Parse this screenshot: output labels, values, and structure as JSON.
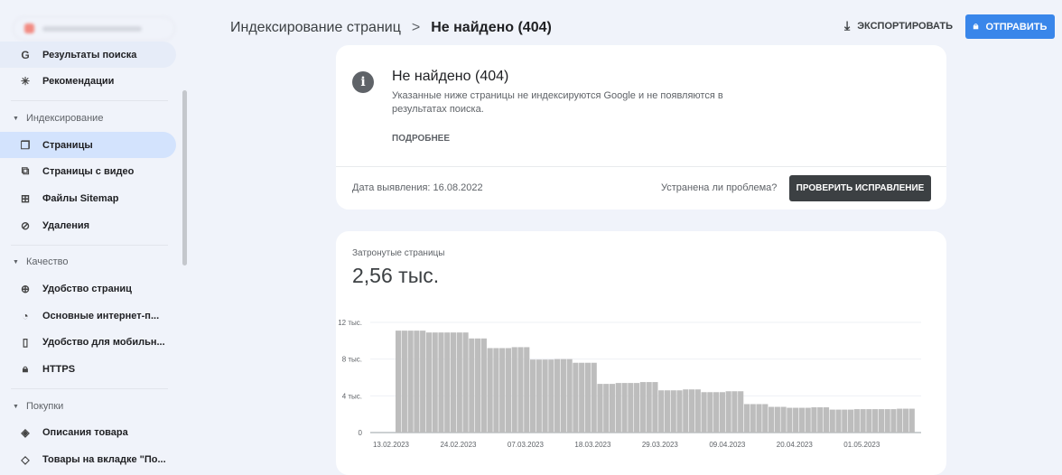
{
  "sidebar": {
    "items": [
      {
        "label": "Результаты поиска",
        "icon": "google-icon"
      },
      {
        "label": "Рекомендации",
        "icon": "asterisk-icon"
      },
      {
        "label": "Страницы",
        "icon": "pages-icon"
      },
      {
        "label": "Страницы с видео",
        "icon": "video-pages-icon"
      },
      {
        "label": "Файлы Sitemap",
        "icon": "sitemap-icon"
      },
      {
        "label": "Удаления",
        "icon": "eye-off-icon"
      },
      {
        "label": "Удобство страниц",
        "icon": "plus-circle-icon"
      },
      {
        "label": "Основные интернет-п...",
        "icon": "speedometer-icon"
      },
      {
        "label": "Удобство для мобильн...",
        "icon": "phone-icon"
      },
      {
        "label": "HTTPS",
        "icon": "lock-icon"
      },
      {
        "label": "Описания товара",
        "icon": "layers-icon"
      },
      {
        "label": "Товары на вкладке \"По...",
        "icon": "tag-icon"
      }
    ],
    "sections": [
      "Индексирование",
      "Качество",
      "Покупки"
    ]
  },
  "header": {
    "crumb_parent": "Индексирование страниц",
    "crumb_sep": ">",
    "crumb_current": "Не найдено (404)",
    "export_label": "ЭКСПОРТИРОВАТЬ",
    "send_label": "ОТПРАВИТЬ"
  },
  "issue": {
    "title": "Не найдено (404)",
    "description": "Указанные ниже страницы не индексируются Google и не появляются в результатах поиска.",
    "more_label": "ПОДРОБНЕЕ",
    "date_label": "Дата выявления: 16.08.2022",
    "question": "Устранена ли проблема?",
    "fix_label": "ПРОВЕРИТЬ ИСПРАВЛЕНИЕ"
  },
  "affected": {
    "label": "Затронутые страницы",
    "value": "2,56 тыс."
  },
  "chart_data": {
    "type": "bar",
    "title": "",
    "xlabel": "",
    "ylabel": "",
    "ylim": [
      0,
      12000
    ],
    "yticks": [
      {
        "v": 0,
        "label": "0"
      },
      {
        "v": 4000,
        "label": "4 тыс."
      },
      {
        "v": 8000,
        "label": "8 тыс."
      },
      {
        "v": 12000,
        "label": "12 тыс."
      }
    ],
    "xtick_labels": [
      "13.02.2023",
      "24.02.2023",
      "07.03.2023",
      "18.03.2023",
      "29.03.2023",
      "09.04.2023",
      "20.04.2023",
      "01.05.2023"
    ],
    "xtick_every_days": 11,
    "segments": [
      [
        5,
        11100
      ],
      [
        7,
        10900
      ],
      [
        3,
        10250
      ],
      [
        4,
        9200
      ],
      [
        3,
        9300
      ],
      [
        4,
        7950
      ],
      [
        3,
        8000
      ],
      [
        4,
        7600
      ],
      [
        3,
        5300
      ],
      [
        4,
        5400
      ],
      [
        3,
        5500
      ],
      [
        4,
        4600
      ],
      [
        3,
        4700
      ],
      [
        4,
        4400
      ],
      [
        3,
        4500
      ],
      [
        4,
        3100
      ],
      [
        3,
        2800
      ],
      [
        4,
        2700
      ],
      [
        3,
        2750
      ],
      [
        4,
        2500
      ],
      [
        7,
        2550
      ],
      [
        3,
        2600
      ]
    ],
    "color": "#bdbdbd"
  }
}
